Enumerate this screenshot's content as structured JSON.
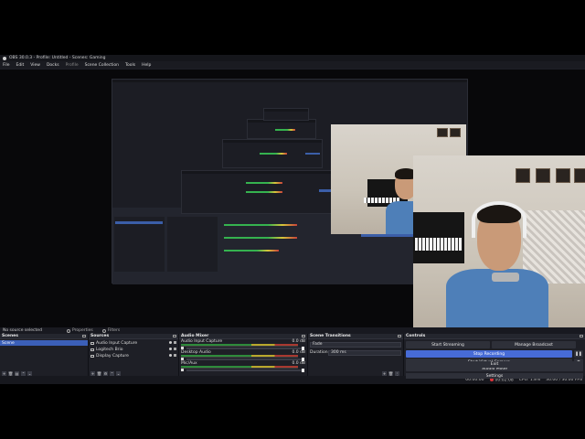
{
  "window": {
    "title": "OBS 30.0.3 - Profile: Untitled - Scenes: Gaming"
  },
  "menu": [
    "File",
    "Edit",
    "View",
    "Docks",
    "Profile",
    "Scene Collection",
    "Tools",
    "Help"
  ],
  "source_toolbar": {
    "no_selection": "No source selected",
    "properties": "Properties",
    "filters": "Filters"
  },
  "scenes": {
    "title": "Scenes",
    "items": [
      "Scene"
    ]
  },
  "sources": {
    "title": "Sources",
    "items": [
      "Audio Input Capture",
      "Logitech Brio",
      "Display Capture"
    ]
  },
  "mixer": {
    "title": "Audio Mixer",
    "channels": [
      {
        "name": "Audio Input Capture",
        "db": "0.0 dB"
      },
      {
        "name": "Desktop Audio",
        "db": "0.0 dB"
      },
      {
        "name": "Mic/Aux",
        "db": "0.0 dB"
      }
    ]
  },
  "transitions": {
    "title": "Scene Transitions",
    "type": "Fade",
    "duration_label": "Duration",
    "duration": "300 ms"
  },
  "controls": {
    "title": "Controls",
    "start_streaming": "Start Streaming",
    "manage_broadcast": "Manage Broadcast",
    "stop_recording": "Stop Recording",
    "start_virtual_camera": "Start Virtual Camera",
    "studio_mode": "Studio Mode",
    "settings": "Settings",
    "exit": "Exit"
  },
  "status": {
    "stream_time": "00:00:00",
    "rec_time": "00:02:08",
    "cpu": "CPU: 1.8%",
    "fps": "30.00 / 30.00 FPS"
  },
  "colors": {
    "accent": "#476bd6",
    "record": "#e0343a",
    "background": "#1e1f26"
  }
}
